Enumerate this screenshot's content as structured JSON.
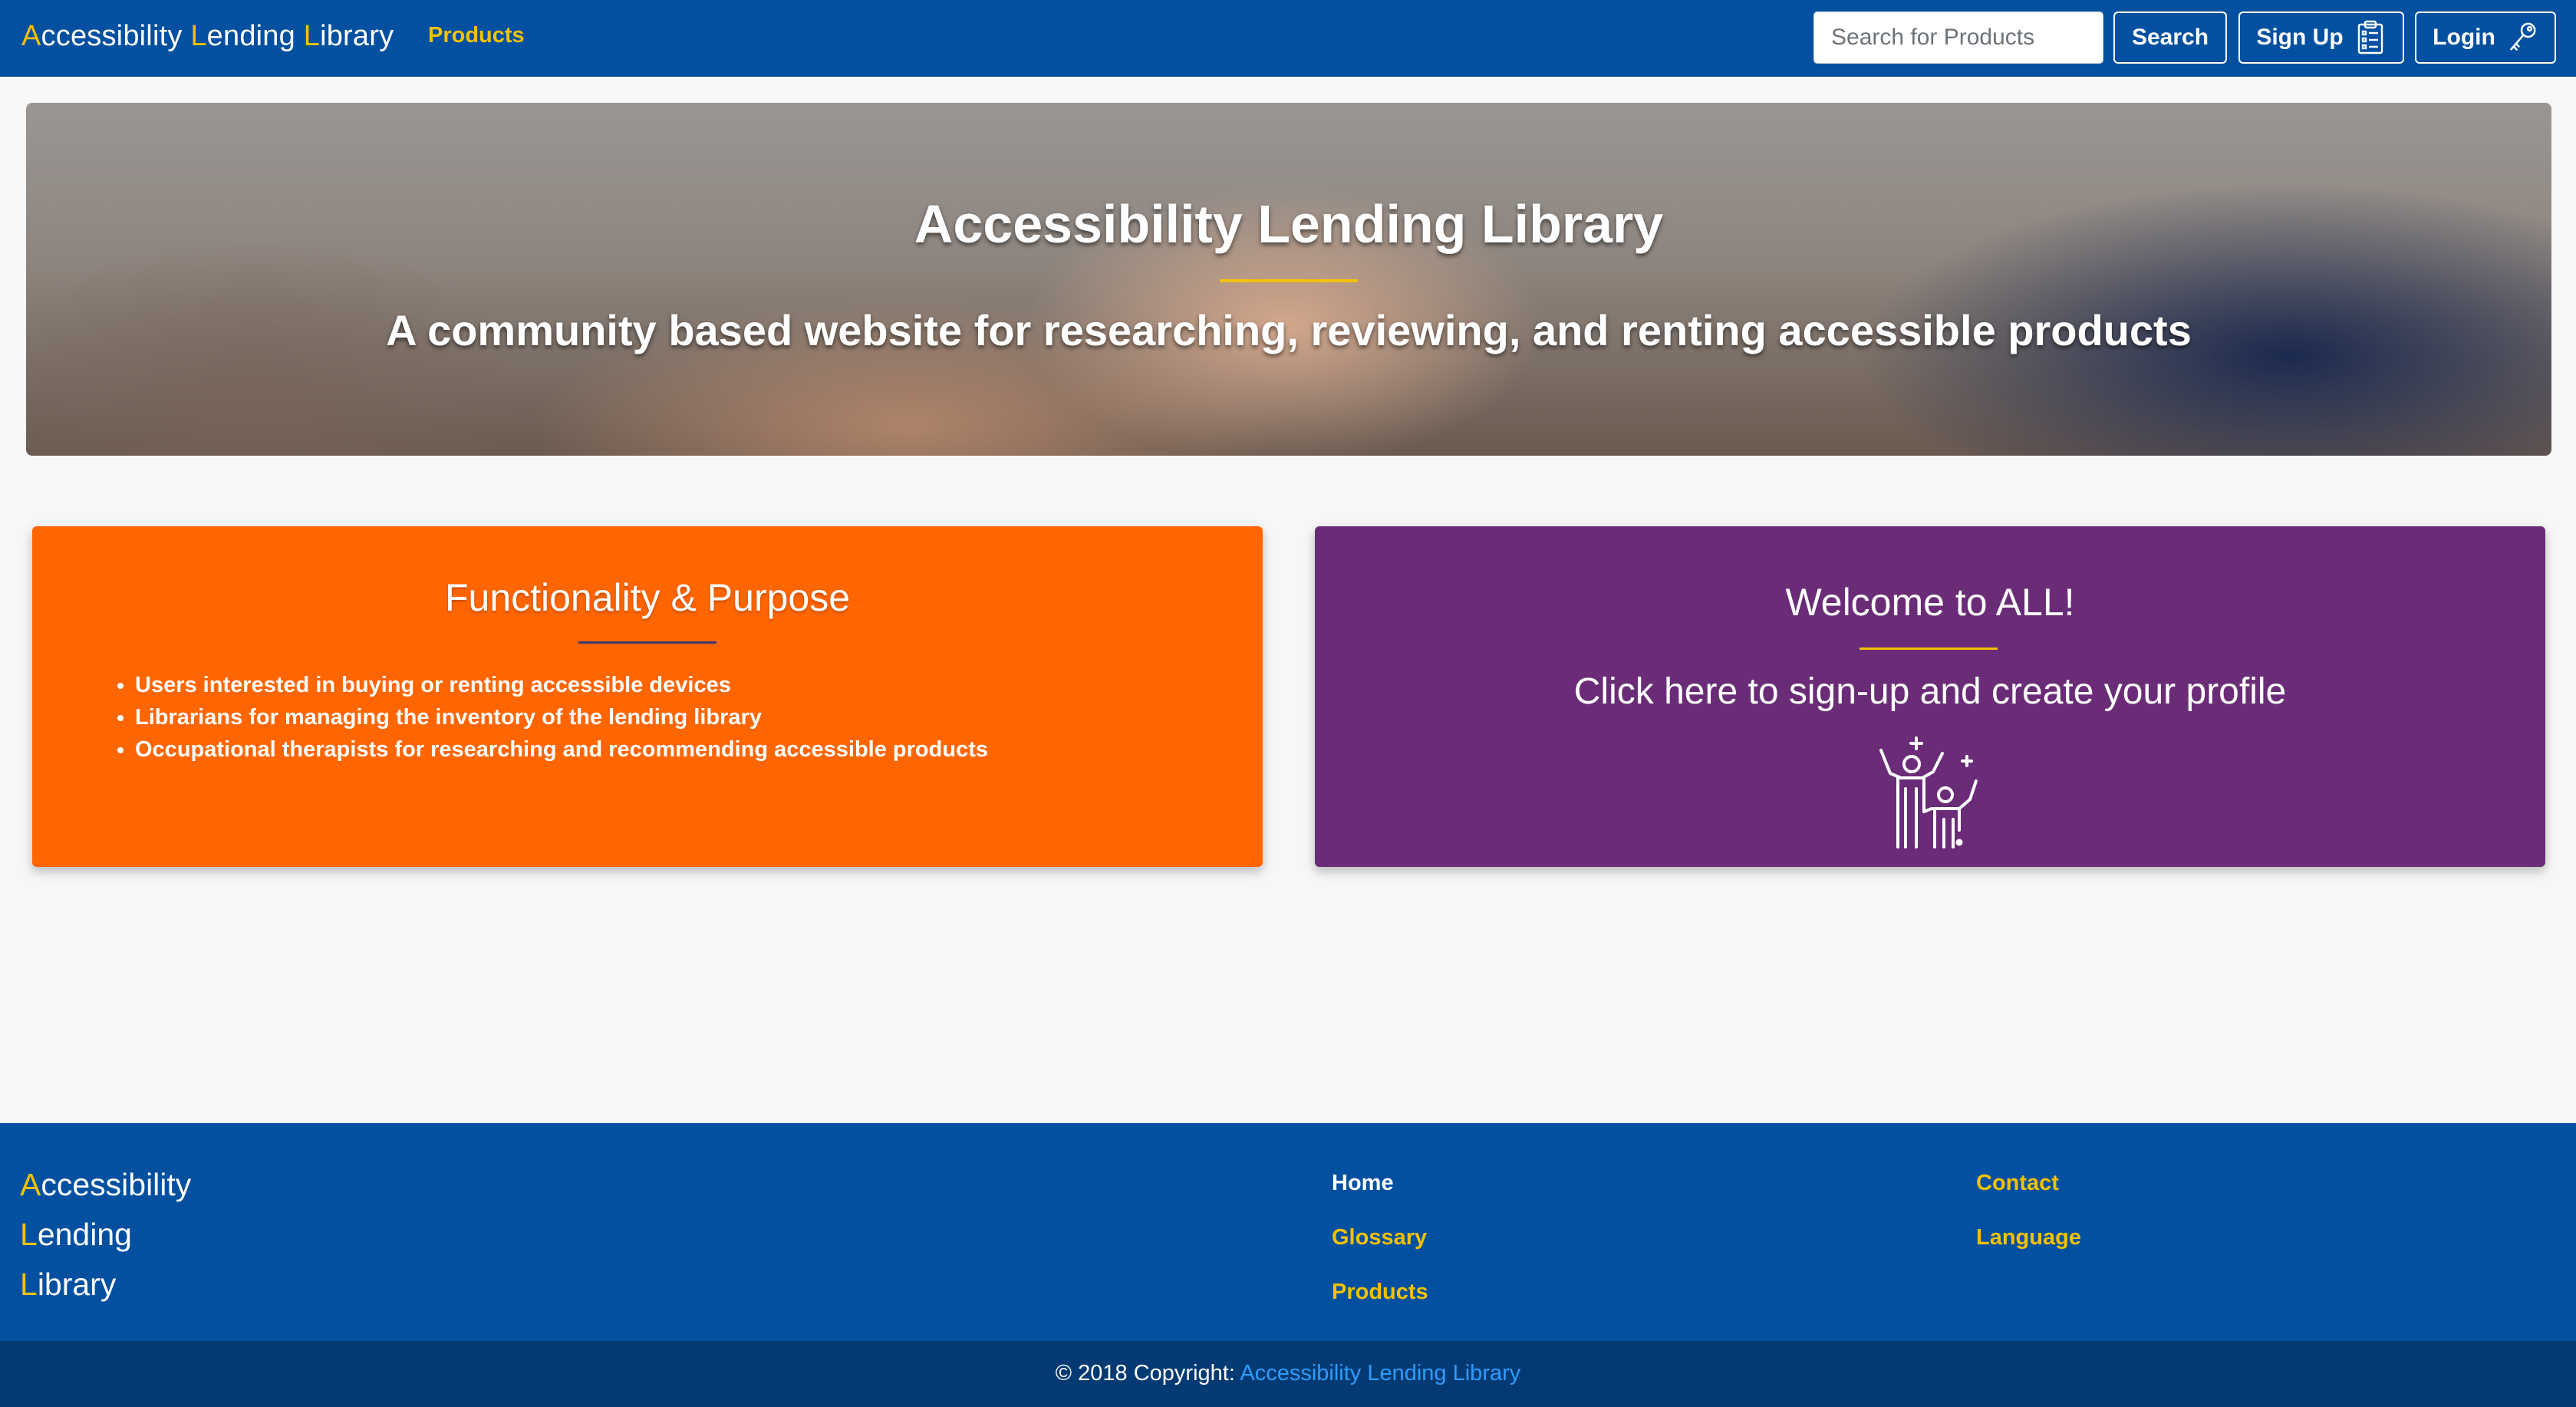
{
  "navbar": {
    "brand": {
      "c1": "A",
      "r1": "ccessibility ",
      "c2": "L",
      "r2": "ending ",
      "c3": "L",
      "r3": "ibrary"
    },
    "products_link": "Products",
    "search_placeholder": "Search for Products",
    "search_button": "Search",
    "signup_button": "Sign Up",
    "signup_icon": "clipboard-icon",
    "login_button": "Login",
    "login_icon": "key-icon"
  },
  "hero": {
    "title": "Accessibility Lending Library",
    "subtitle": "A community based website for researching, reviewing, and renting accessible products"
  },
  "functionality_card": {
    "title": "Functionality & Purpose",
    "items": [
      "Users interested in buying or renting accessible devices",
      "Librarians for managing the inventory of the lending library",
      "Occupational therapists for researching and recommending accessible products"
    ]
  },
  "welcome_card": {
    "title": "Welcome to ALL!",
    "subtitle": "Click here to sign-up and create your profile",
    "icon": "celebrating-people-icon"
  },
  "footer": {
    "brand": [
      {
        "cap": "A",
        "rest": "ccessibility"
      },
      {
        "cap": "L",
        "rest": "ending"
      },
      {
        "cap": "L",
        "rest": "ibrary"
      }
    ],
    "links": {
      "home": "Home",
      "glossary": "Glossary",
      "products": "Products",
      "contact": "Contact",
      "language": "Language"
    },
    "copyright_prefix": "© 2018 Copyright: ",
    "copyright_link": "Accessibility Lending Library"
  },
  "colors": {
    "navbar": "#0350a0",
    "accent_yellow": "#f3c100",
    "card_orange": "#ff6501",
    "card_purple": "#6a2c77",
    "bottom_bar": "#033a73"
  }
}
